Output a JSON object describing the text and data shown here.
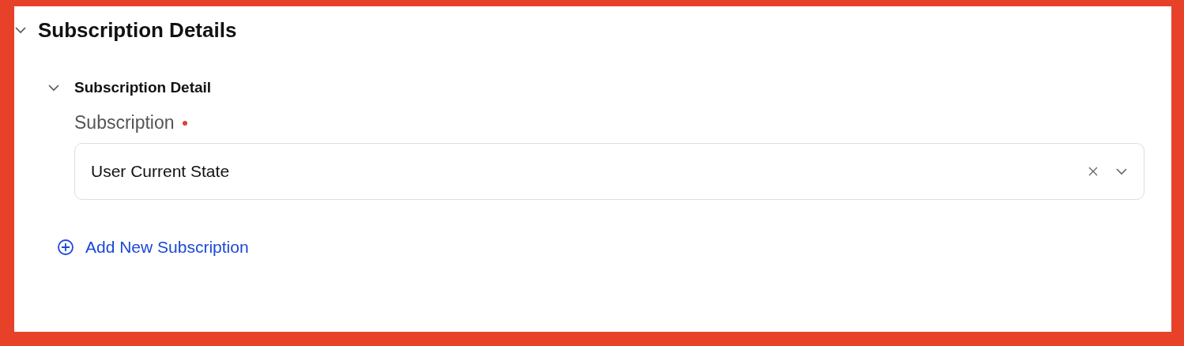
{
  "section": {
    "title": "Subscription Details",
    "expanded": true,
    "groups": [
      {
        "title": "Subscription Detail",
        "expanded": true,
        "field": {
          "label": "Subscription",
          "required": true,
          "value": "User Current State"
        }
      }
    ],
    "add_link": "Add New Subscription"
  }
}
